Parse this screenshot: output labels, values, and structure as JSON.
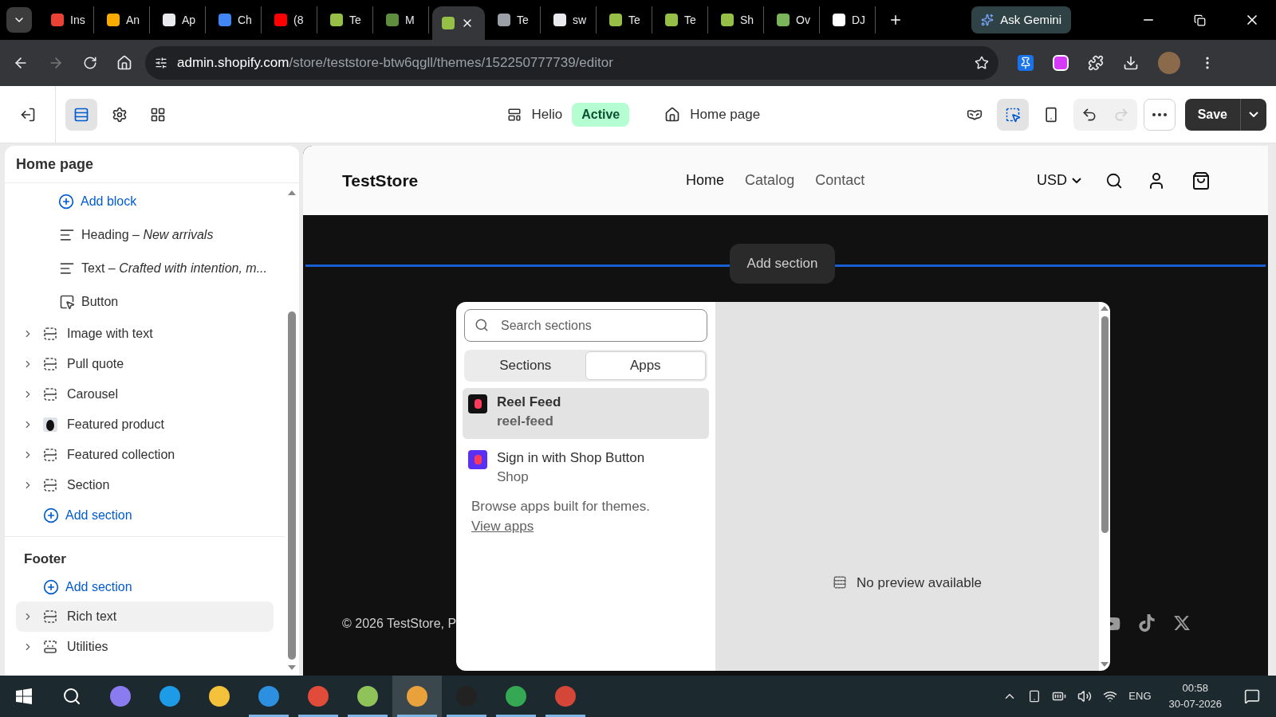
{
  "browser": {
    "tabs": [
      {
        "title": "Ins",
        "color": "#ea4335",
        "selected": false
      },
      {
        "title": "An",
        "color": "#f9ab00",
        "selected": false
      },
      {
        "title": "Ap",
        "color": "#e8eaed",
        "selected": false
      },
      {
        "title": "Ch",
        "color": "#4285f4",
        "selected": false
      },
      {
        "title": "(8",
        "color": "#ff0000",
        "selected": false
      },
      {
        "title": "Te",
        "color": "#95bf47",
        "selected": false
      },
      {
        "title": "M",
        "color": "#5e8e3e",
        "selected": false
      },
      {
        "color": "#95bf47",
        "selected": true
      },
      {
        "title": "Te",
        "color": "#9aa0a6",
        "selected": false
      },
      {
        "title": "sw",
        "color": "#e8eaed",
        "selected": false
      },
      {
        "title": "Te",
        "color": "#95bf47",
        "selected": false
      },
      {
        "title": "Te",
        "color": "#95bf47",
        "selected": false
      },
      {
        "title": "Sh",
        "color": "#95bf47",
        "selected": false
      },
      {
        "title": "Ov",
        "color": "#7ab55c",
        "selected": false
      },
      {
        "title": "DJ",
        "color": "#ffffff",
        "selected": false
      }
    ],
    "ask_button": "Ask Gemini",
    "url_host": "admin.shopify.com",
    "url_path": "/store/teststore-btw6qgll/themes/152250777739/editor"
  },
  "toolbar": {
    "tools": [
      {
        "kind": "sections",
        "selected": true
      },
      {
        "kind": "settings",
        "selected": false
      },
      {
        "kind": "apps",
        "selected": false
      }
    ],
    "theme": "Helio",
    "theme_badge": "Active",
    "page": "Home page",
    "view_tools": [
      {
        "kind": "preview",
        "selected": false
      },
      {
        "kind": "inspector",
        "selected": true
      },
      {
        "kind": "mobile",
        "selected": false
      }
    ],
    "history": [
      {
        "kind": "undo",
        "disabled": false
      },
      {
        "kind": "redo",
        "disabled": true
      }
    ],
    "save": "Save"
  },
  "sidebar": {
    "title": "Home page",
    "blocks": [
      {
        "kind": "add",
        "label": "Add block"
      },
      {
        "kind": "text",
        "label": "Heading – *New arrivals*"
      },
      {
        "kind": "text",
        "label": "Text – *Crafted with intention, m...*"
      },
      {
        "kind": "button",
        "label": "Button"
      }
    ],
    "sections": [
      {
        "label": "Image with text",
        "kind": "section",
        "expanded": false,
        "selected": false
      },
      {
        "label": "Pull quote",
        "kind": "section",
        "expanded": false,
        "selected": false
      },
      {
        "label": "Carousel",
        "kind": "section",
        "expanded": false,
        "selected": false
      },
      {
        "label": "Featured product",
        "kind": "product",
        "expanded": false,
        "selected": false
      },
      {
        "label": "Featured collection",
        "kind": "section",
        "expanded": false,
        "selected": false
      },
      {
        "label": "Section",
        "kind": "section",
        "expanded": false,
        "selected": false
      }
    ],
    "add_section": "Add section",
    "groups": [
      {
        "title": "Footer",
        "add_section": "Add section",
        "sections": [
          {
            "label": "Rich text",
            "kind": "section",
            "expanded": false,
            "selected": true
          },
          {
            "label": "Utilities",
            "kind": "utilities",
            "expanded": false,
            "selected": false
          }
        ]
      }
    ]
  },
  "preview": {
    "store_name": "TestStore",
    "nav": [
      {
        "label": "Home",
        "selected": true
      },
      {
        "label": "Catalog",
        "selected": false
      },
      {
        "label": "Contact",
        "selected": false
      }
    ],
    "currency": "USD",
    "add_section": "Add section",
    "copyright": "© 2026 TestStore, P"
  },
  "popup": {
    "search_placeholder": "Search sections",
    "tabs": [
      {
        "label": "Sections",
        "selected": false
      },
      {
        "label": "Apps",
        "selected": true
      }
    ],
    "apps": [
      {
        "name": "Reel Feed",
        "handle": "reel-feed",
        "color": "#111111",
        "selected": true
      },
      {
        "name": "Sign in with Shop Button",
        "handle": "Shop",
        "color": "#5a31f4",
        "selected": false
      }
    ],
    "browse_text": "Browse apps built for themes.",
    "browse_link": "View apps",
    "preview_text": "No preview available"
  },
  "taskbar": {
    "apps": [
      {
        "color": "#8a7bf0",
        "running": false,
        "selected": false
      },
      {
        "color": "#1e9be6",
        "running": false,
        "selected": false
      },
      {
        "color": "#f3c13a",
        "running": false,
        "selected": false
      },
      {
        "color": "#2d8fe0",
        "running": true,
        "selected": false
      },
      {
        "color": "#e04b3a",
        "running": true,
        "selected": false
      },
      {
        "color": "#8fc35a",
        "running": true,
        "selected": false
      },
      {
        "color": "#e9a23b",
        "running": true,
        "selected": true
      },
      {
        "color": "#222222",
        "running": true,
        "selected": false
      },
      {
        "color": "#34a853",
        "running": true,
        "selected": false
      },
      {
        "color": "#d44638",
        "running": true,
        "selected": false
      }
    ],
    "language": "ENG",
    "time": "00:58",
    "date": "30-07-2026"
  }
}
